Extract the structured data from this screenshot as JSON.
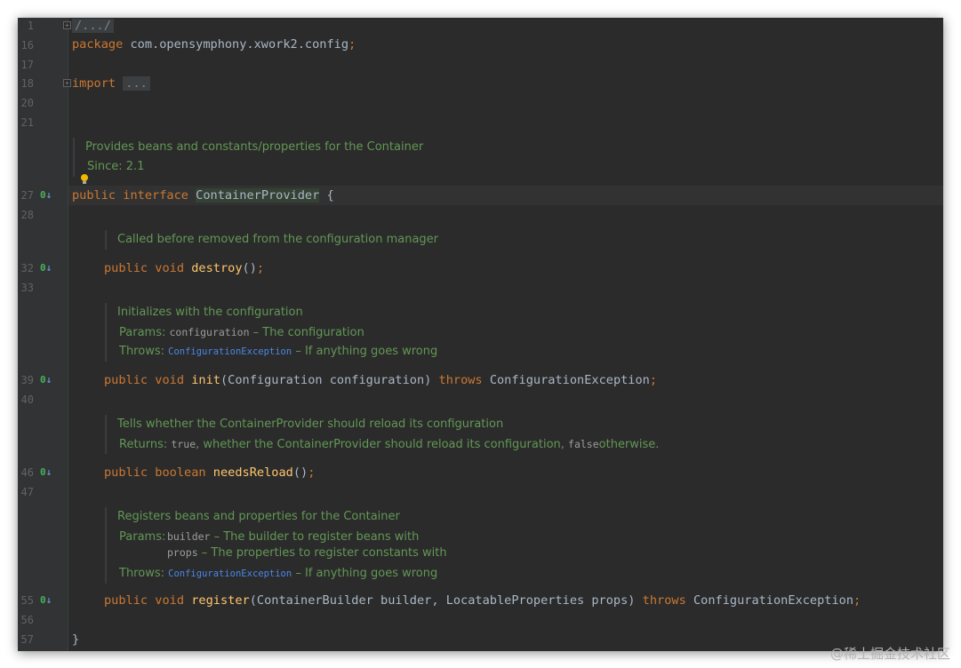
{
  "editor": {
    "line_numbers": [
      "1",
      "16",
      "17",
      "18",
      "20",
      "21",
      "27",
      "28",
      "32",
      "33",
      "39",
      "40",
      "46",
      "47",
      "55",
      "56",
      "57"
    ],
    "lines": {
      "l1": "/.../",
      "package_kw": "package",
      "package_name": "com.opensymphony.xwork2.config",
      "import_kw": "import",
      "import_fold": "...",
      "interface_public": "public",
      "interface_kw": "interface",
      "interface_name": "ContainerProvider",
      "interface_brace": "{",
      "destroy_public": "public",
      "destroy_void": "void",
      "destroy_name": "destroy",
      "destroy_parens": "()",
      "init_public": "public",
      "init_void": "void",
      "init_name": "init",
      "init_params": "(Configuration configuration)",
      "init_throws": "throws",
      "init_exception": "ConfigurationException",
      "reload_public": "public",
      "reload_type": "boolean",
      "reload_name": "needsReload",
      "reload_parens": "()",
      "register_public": "public",
      "register_void": "void",
      "register_name": "register",
      "register_params": "(ContainerBuilder builder, LocatableProperties props)",
      "register_throws": "throws",
      "register_exception": "ConfigurationException",
      "close_brace": "}",
      "semicolon": ";"
    },
    "docs": {
      "class_desc": "Provides beans and constants/properties for the Container",
      "class_since": "Since: 2.1",
      "destroy_desc": "Called before removed from the configuration manager",
      "init_desc": "Initializes with the configuration",
      "init_params_label": "Params:",
      "init_param_name": "configuration",
      "init_param_desc": "– The configuration",
      "init_throws_label": "Throws:",
      "init_throws_name": "ConfigurationException",
      "init_throws_desc": "– If anything goes wrong",
      "reload_desc": "Tells whether the ContainerProvider should reload its configuration",
      "reload_returns_label": "Returns:",
      "reload_true": "true",
      "reload_returns_mid": ", whether the ContainerProvider should reload its configuration,",
      "reload_false": "false",
      "reload_returns_end": "otherwise.",
      "register_desc": "Registers beans and properties for the Container",
      "register_params_label": "Params:",
      "register_param1_name": "builder",
      "register_param1_desc": "– The builder to register beans with",
      "register_param2_name": "props",
      "register_param2_desc": "– The properties to register constants with",
      "register_throws_label": "Throws:",
      "register_throws_name": "ConfigurationException",
      "register_throws_desc": "– If anything goes wrong"
    }
  },
  "watermark": "@稀土掘金技术社区",
  "colors": {
    "background": "#2b2b2b",
    "keyword": "#cc7832",
    "method": "#ffc66d",
    "doc_text": "#629755",
    "link": "#4a86e8",
    "plain": "#a9b7c6"
  }
}
